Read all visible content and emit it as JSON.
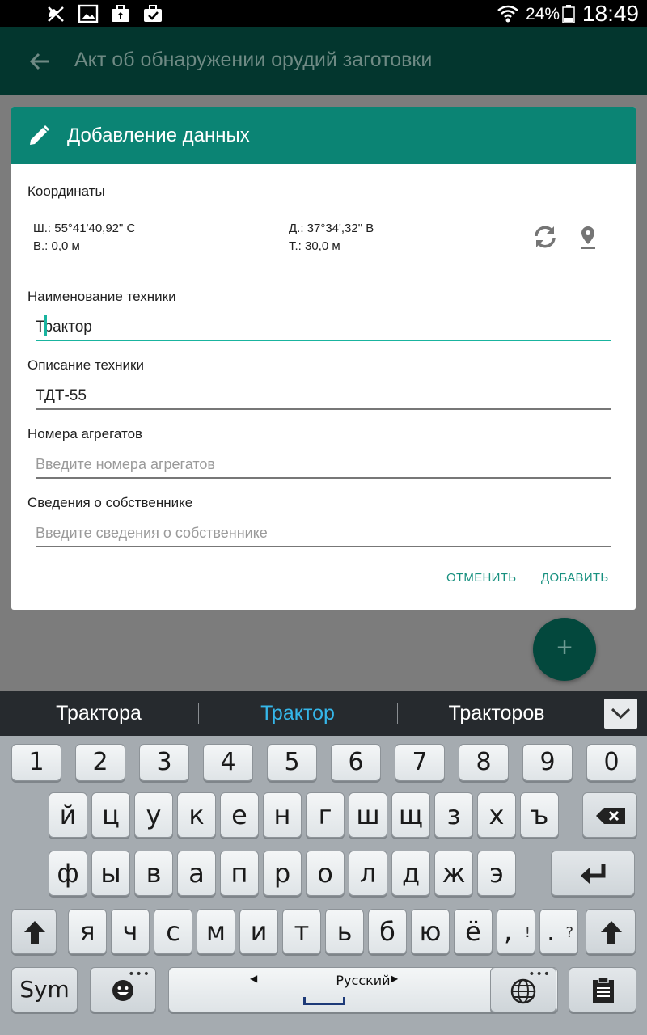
{
  "status_bar": {
    "battery_percent": "24%",
    "time": "18:49",
    "icons": [
      "no-location-icon",
      "image-icon",
      "briefcase-upload-icon",
      "briefcase-check-icon",
      "wifi-icon",
      "battery-icon"
    ]
  },
  "app_bar": {
    "title": "Акт об обнаружении орудий заготовки",
    "back_icon": "arrow-back-icon"
  },
  "dialog": {
    "title": "Добавление данных",
    "title_icon": "pencil-icon",
    "coordinates": {
      "label": "Координаты",
      "latitude": "Ш.: 55°41'40,92\" С",
      "longitude": "Д.: 37°34',32\" В",
      "altitude": "В.: 0,0 м",
      "accuracy": "Т.: 30,0 м",
      "refresh_icon": "refresh-icon",
      "location_icon": "map-marker-icon"
    },
    "fields": [
      {
        "label": "Наименование техники",
        "value": "Трактор",
        "placeholder": ""
      },
      {
        "label": "Описание техники",
        "value": "ТДТ-55",
        "placeholder": ""
      },
      {
        "label": "Номера агрегатов",
        "value": "",
        "placeholder": "Введите номера агрегатов"
      },
      {
        "label": "Сведения о собственнике",
        "value": "",
        "placeholder": "Введите сведения о собственнике"
      }
    ],
    "cancel_label": "ОТМЕНИТЬ",
    "add_label": "ДОБАВИТЬ"
  },
  "fab": {
    "label": "+"
  },
  "suggestions": [
    "Трактора",
    "Трактор",
    "Тракторов"
  ],
  "keyboard": {
    "numbers": [
      "1",
      "2",
      "3",
      "4",
      "5",
      "6",
      "7",
      "8",
      "9",
      "0"
    ],
    "row1": [
      "й",
      "ц",
      "у",
      "к",
      "е",
      "н",
      "г",
      "ш",
      "щ",
      "з",
      "х",
      "ъ"
    ],
    "row2": [
      "ф",
      "ы",
      "в",
      "а",
      "п",
      "р",
      "о",
      "л",
      "д",
      "ж",
      "э"
    ],
    "row3": [
      "я",
      "ч",
      "с",
      "м",
      "и",
      "т",
      "ь",
      "б",
      "ю",
      "ё"
    ],
    "comma": ",",
    "comma_sup": "!",
    "period": ".",
    "period_sup": "?",
    "sym_label": "Sym",
    "space_label": "Русский",
    "icons": [
      "backspace-icon",
      "enter-icon",
      "shift-icon",
      "emoji-icon",
      "globe-icon",
      "clipboard-icon",
      "chevron-down-icon"
    ]
  }
}
